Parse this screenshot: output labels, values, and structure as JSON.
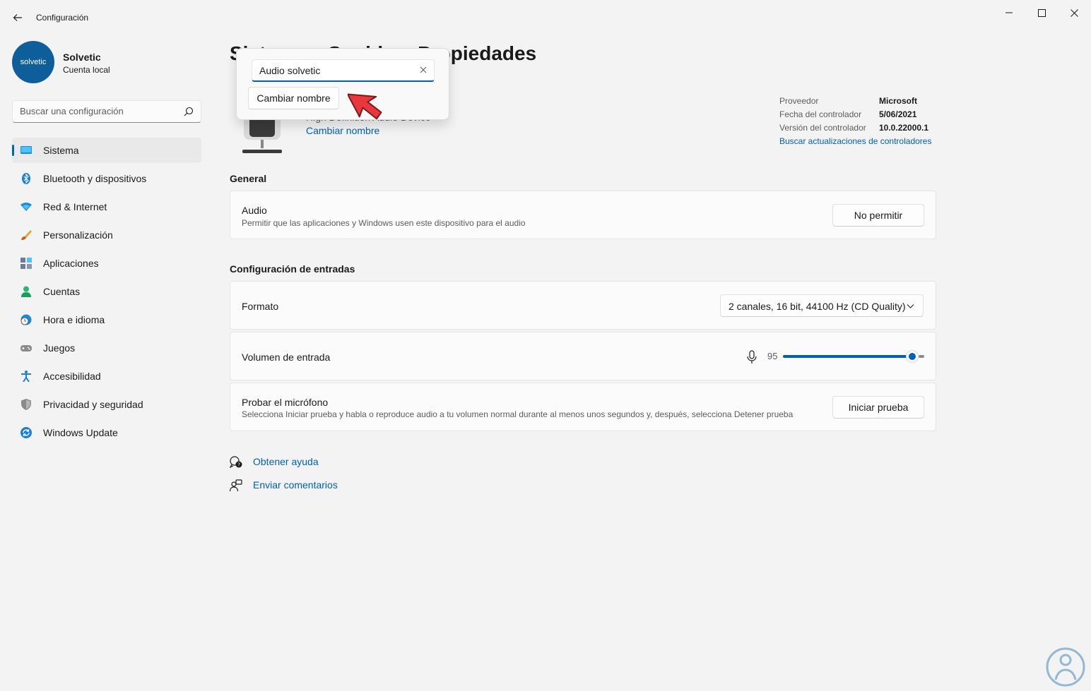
{
  "window": {
    "title": "Configuración"
  },
  "profile": {
    "name": "Solvetic",
    "subtitle": "Cuenta local",
    "avatar_text": "solvetic"
  },
  "search": {
    "placeholder": "Buscar una configuración"
  },
  "nav": [
    {
      "label": "Sistema",
      "icon": "monitor-icon",
      "active": true
    },
    {
      "label": "Bluetooth y dispositivos",
      "icon": "bluetooth-icon"
    },
    {
      "label": "Red & Internet",
      "icon": "wifi-icon"
    },
    {
      "label": "Personalización",
      "icon": "brush-icon"
    },
    {
      "label": "Aplicaciones",
      "icon": "apps-icon"
    },
    {
      "label": "Cuentas",
      "icon": "person-icon"
    },
    {
      "label": "Hora e idioma",
      "icon": "clock-globe-icon"
    },
    {
      "label": "Juegos",
      "icon": "gamepad-icon"
    },
    {
      "label": "Accesibilidad",
      "icon": "accessibility-icon"
    },
    {
      "label": "Privacidad y seguridad",
      "icon": "shield-icon"
    },
    {
      "label": "Windows Update",
      "icon": "update-icon"
    }
  ],
  "main": {
    "title": "Sistema  >  Sonido  >  Propiedades",
    "device_subtitle": "High Definition Audio Device",
    "rename_link": "Cambiar nombre",
    "driver": {
      "rows": [
        {
          "label": "Proveedor",
          "value": "Microsoft"
        },
        {
          "label": "Fecha del controlador",
          "value": "5/06/2021"
        },
        {
          "label": "Versión del controlador",
          "value": "10.0.22000.1"
        }
      ],
      "update_link": "Buscar actualizaciones de controladores"
    },
    "general": {
      "heading": "General",
      "audio_title": "Audio",
      "audio_desc": "Permitir que las aplicaciones y Windows usen este dispositivo para el audio",
      "audio_button": "No permitir"
    },
    "input": {
      "heading": "Configuración de entradas",
      "format_label": "Formato",
      "format_value": "2 canales, 16 bit, 44100 Hz (CD Quality)",
      "volume_label": "Volumen de entrada",
      "volume_value": "95",
      "test_title": "Probar el micrófono",
      "test_desc": "Selecciona Iniciar prueba y habla o reproduce audio a tu volumen normal durante al menos unos segundos y, después, selecciona Detener prueba",
      "test_button": "Iniciar prueba"
    },
    "help": {
      "get_help": "Obtener ayuda",
      "feedback": "Enviar comentarios"
    }
  },
  "flyout": {
    "input_value": "Audio solvetic",
    "button": "Cambiar nombre"
  },
  "colors": {
    "accent": "#005fb8",
    "background": "#f3f3f3",
    "card": "#fbfbfb",
    "cursor": "#e8373d"
  }
}
